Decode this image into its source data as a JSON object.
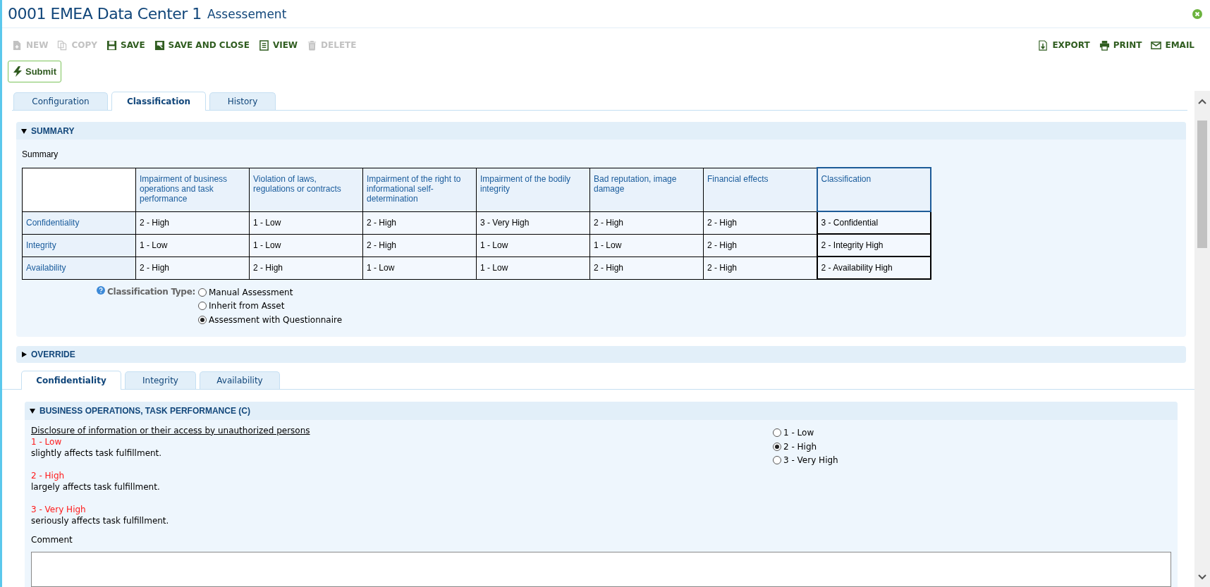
{
  "header": {
    "title": "0001 EMEA Data Center 1",
    "subtitle": "Assessement"
  },
  "toolbar": {
    "left": [
      {
        "label": "NEW",
        "disabled": true
      },
      {
        "label": "COPY",
        "disabled": true
      },
      {
        "label": "SAVE",
        "disabled": false
      },
      {
        "label": "SAVE AND CLOSE",
        "disabled": false
      },
      {
        "label": "VIEW",
        "disabled": false
      },
      {
        "label": "DELETE",
        "disabled": true
      }
    ],
    "right": [
      {
        "label": "EXPORT",
        "disabled": false
      },
      {
        "label": "PRINT",
        "disabled": false
      },
      {
        "label": "EMAIL",
        "disabled": false
      }
    ]
  },
  "submit_button": "Submit",
  "tabs": [
    {
      "label": "Configuration",
      "selected": false
    },
    {
      "label": "Classification",
      "selected": true
    },
    {
      "label": "History",
      "selected": false
    }
  ],
  "summary": {
    "title": "SUMMARY",
    "expanded": true,
    "caption": "Summary",
    "table": {
      "columns": [
        "Impairment of business operations and task performance",
        "Violation of laws, regulations or contracts",
        "Impairment of the right to informational self-determination",
        "Impairment of the bodily integrity",
        "Bad reputation, image damage",
        "Financial effects",
        "Classification"
      ],
      "rows": [
        {
          "label": "Confidentiality",
          "cells": [
            "2 - High",
            "1 - Low",
            "2 - High",
            "3 - Very High",
            "2 - High",
            "2 - High",
            "3 - Confidential"
          ]
        },
        {
          "label": "Integrity",
          "cells": [
            "1 - Low",
            "1 - Low",
            "2 - High",
            "1 - Low",
            "1 - Low",
            "2 - High",
            "2 - Integrity High"
          ]
        },
        {
          "label": "Availability",
          "cells": [
            "2 - High",
            "2 - High",
            "1 - Low",
            "1 - Low",
            "2 - High",
            "2 - High",
            "2 - Availability High"
          ]
        }
      ]
    },
    "classification_type": {
      "label": "Classification Type:",
      "options": [
        {
          "label": "Manual Assessment",
          "selected": false
        },
        {
          "label": "Inherit from Asset",
          "selected": false
        },
        {
          "label": "Assessment with Questionnaire",
          "selected": true
        }
      ]
    }
  },
  "override": {
    "title": "OVERRIDE",
    "expanded": false
  },
  "subtabs": [
    {
      "label": "Confidentiality",
      "selected": true
    },
    {
      "label": "Integrity",
      "selected": false
    },
    {
      "label": "Availability",
      "selected": false
    }
  ],
  "section": {
    "title": "BUSINESS OPERATIONS, TASK PERFORMANCE (C)",
    "expanded": true,
    "question": "Disclosure of information or their access by unauthorized persons",
    "levels": [
      {
        "label": "1 - Low",
        "description": "slightly affects task fulfillment."
      },
      {
        "label": "2 - High",
        "description": "largely affects task fulfillment."
      },
      {
        "label": "3 - Very High",
        "description": "seriously affects task fulfillment."
      }
    ],
    "options": [
      {
        "label": "1 - Low",
        "selected": false
      },
      {
        "label": "2 - High",
        "selected": true
      },
      {
        "label": "3 - Very High",
        "selected": false
      }
    ],
    "comment_label": "Comment"
  }
}
